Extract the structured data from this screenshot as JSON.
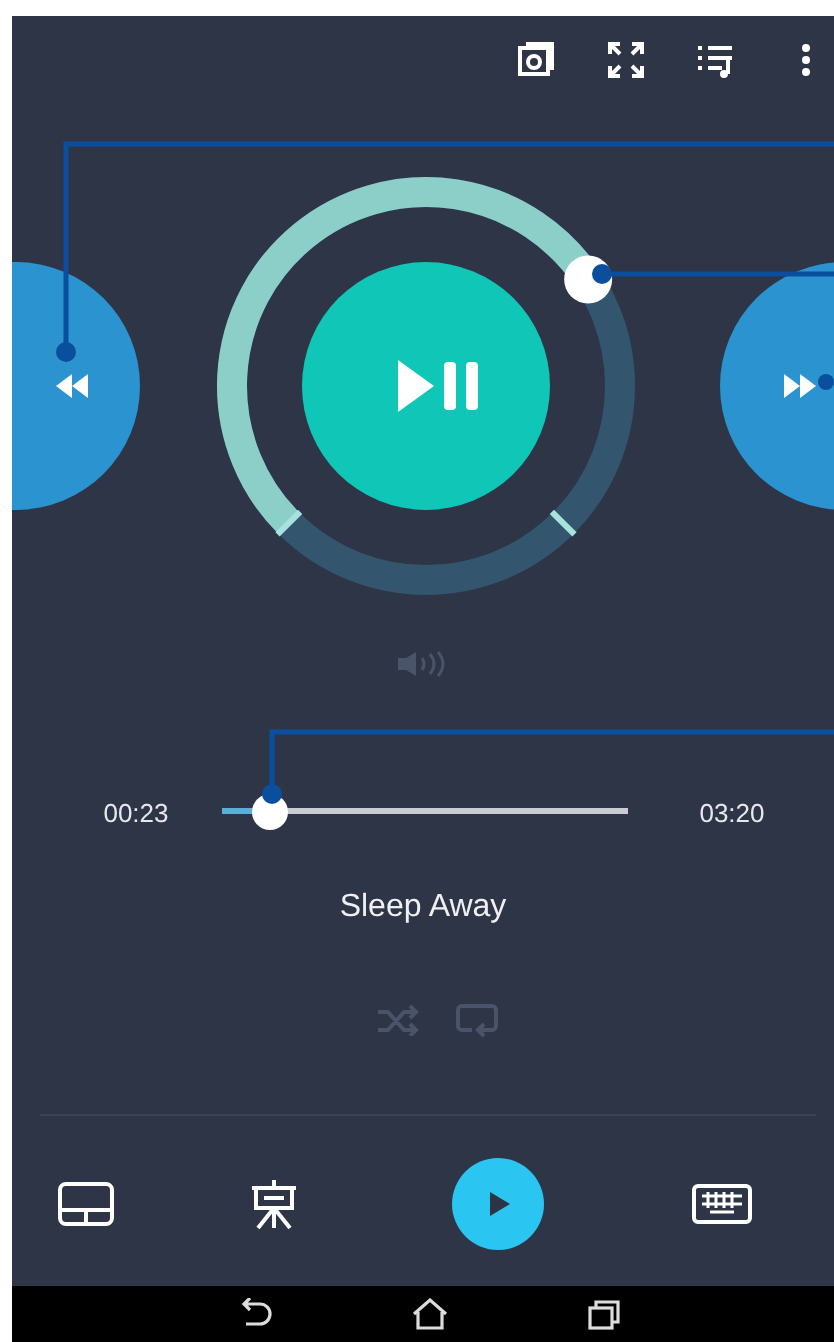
{
  "top_bar": {
    "icons": [
      {
        "kind": "cast"
      },
      {
        "kind": "fullscreen"
      },
      {
        "kind": "playlist"
      },
      {
        "kind": "more"
      }
    ]
  },
  "player": {
    "ring": {
      "level": 0.71
    },
    "seek": {
      "elapsed": "00:23",
      "level": 0.12,
      "duration": "03:20"
    },
    "title": "Sleep Away"
  },
  "bottom_bar": {
    "items": [
      {
        "kind": "touchpad"
      },
      {
        "kind": "presentation"
      },
      {
        "kind": "play"
      },
      {
        "kind": "keyboard"
      }
    ]
  },
  "nav_bar": {
    "items": [
      {
        "kind": "back"
      },
      {
        "kind": "home"
      },
      {
        "kind": "recent"
      }
    ]
  }
}
